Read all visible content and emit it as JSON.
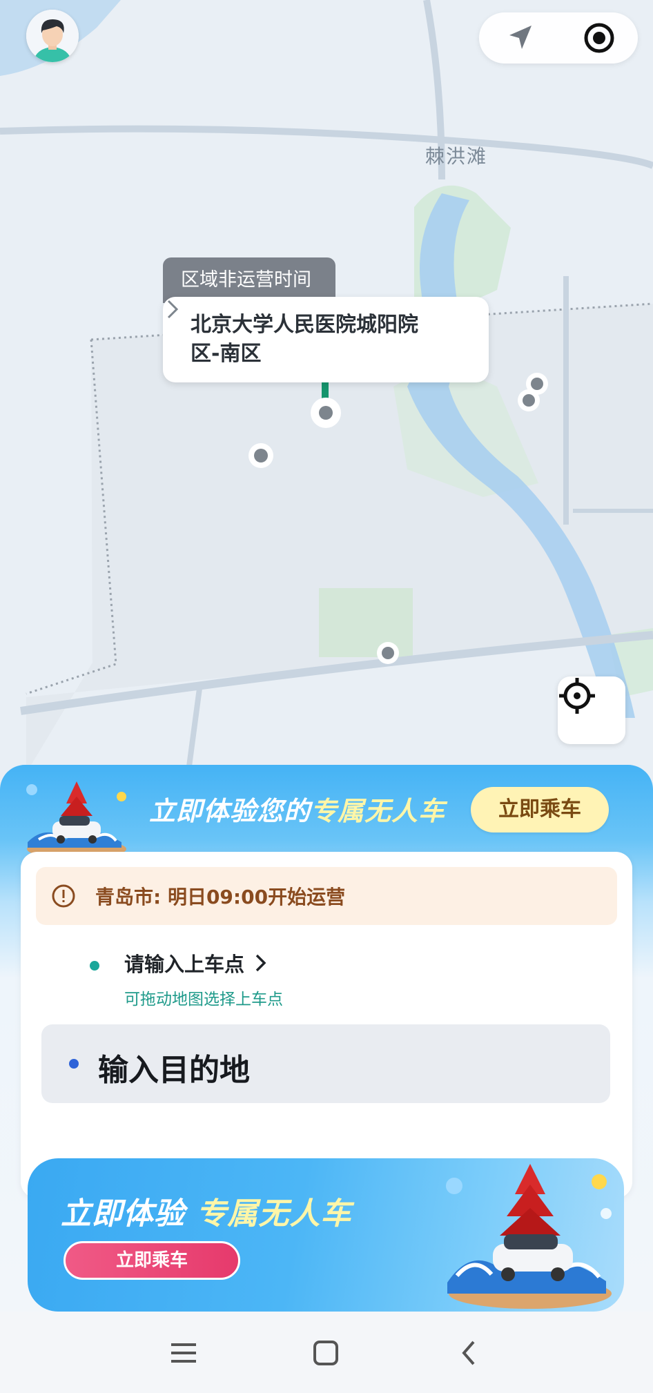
{
  "map": {
    "place_label": "棘洪滩",
    "callout_tag": "区域非运营时间",
    "callout_title": "北京大学人民医院城阳院区-南区",
    "icons": [
      "nav-arrow-icon",
      "target-icon",
      "locate-icon",
      "chevron-right-icon"
    ]
  },
  "promo_head": {
    "text_prefix": "立即体验您的",
    "text_highlight": "专属无人车",
    "button_label": "立即乘车"
  },
  "card": {
    "notice": "青岛市: 明日09:00开始运营",
    "pickup_title": "请输入上车点",
    "pickup_hint": "可拖动地图选择上车点",
    "destination_placeholder": "输入目的地"
  },
  "banner": {
    "text_prefix": "立即体验 ",
    "text_highlight": "专属无人车",
    "button_label": "立即乘车"
  },
  "navbar": {
    "icons": [
      "menu-icon",
      "home-square-icon",
      "back-icon"
    ]
  },
  "colors": {
    "accent_teal": "#1aa79a",
    "accent_blue": "#2e63d8",
    "notice_bg": "#fdf0e4",
    "button_yellow": "#fff3b5",
    "button_pink": "#e63a6c",
    "sheet_blue": "#45b3f5"
  }
}
